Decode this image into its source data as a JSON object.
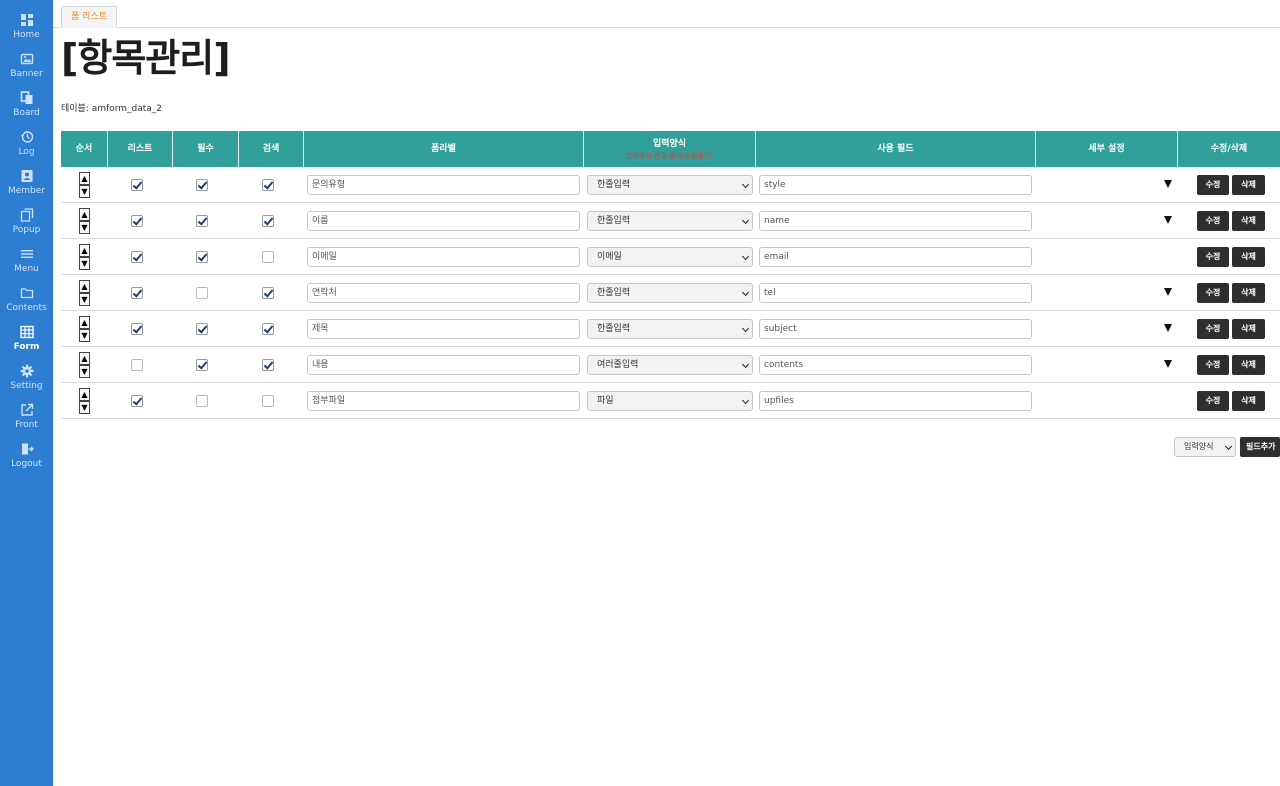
{
  "sidebar": {
    "items": [
      {
        "label": "Home",
        "icon": "dashboard-icon",
        "active": false
      },
      {
        "label": "Banner",
        "icon": "image-icon",
        "active": false
      },
      {
        "label": "Board",
        "icon": "copy-icon",
        "active": false
      },
      {
        "label": "Log",
        "icon": "history-icon",
        "active": false
      },
      {
        "label": "Member",
        "icon": "contact-card-icon",
        "active": false
      },
      {
        "label": "Popup",
        "icon": "popup-icon",
        "active": false
      },
      {
        "label": "Menu",
        "icon": "list-icon",
        "active": false
      },
      {
        "label": "Contents",
        "icon": "folder-icon",
        "active": false
      },
      {
        "label": "Form",
        "icon": "table-icon",
        "active": true
      },
      {
        "label": "Setting",
        "icon": "gear-icon",
        "active": false
      },
      {
        "label": "Front",
        "icon": "external-link-icon",
        "active": false
      },
      {
        "label": "Logout",
        "icon": "logout-icon",
        "active": false
      }
    ]
  },
  "tab": {
    "label": "폼 리스트"
  },
  "page": {
    "title": "[항목관리]",
    "table_label": "테이블: amform_data_2"
  },
  "table": {
    "headers": {
      "order": "순서",
      "list": "리스트",
      "required": "필수",
      "search": "검색",
      "form_label": "폼라벨",
      "input_type": "입력양식",
      "input_type_sub": "입력양식 변경 불가(수정불가)",
      "field": "사용 필드",
      "detail": "세부 설정",
      "actions": "수정/삭제"
    },
    "order_up": "▲",
    "order_down": "▼",
    "edit_label": "수정",
    "delete_label": "삭제",
    "rows": [
      {
        "list": true,
        "required": true,
        "search": true,
        "label": "문의유형",
        "type": "한줄입력",
        "field": "style",
        "has_detail": true
      },
      {
        "list": true,
        "required": true,
        "search": true,
        "label": "이름",
        "type": "한줄입력",
        "field": "name",
        "has_detail": true
      },
      {
        "list": true,
        "required": true,
        "search": false,
        "label": "이메일",
        "type": "이메일",
        "field": "email",
        "has_detail": false
      },
      {
        "list": true,
        "required": false,
        "search": true,
        "label": "연락처",
        "type": "한줄입력",
        "field": "tel",
        "has_detail": true
      },
      {
        "list": true,
        "required": true,
        "search": true,
        "label": "제목",
        "type": "한줄입력",
        "field": "subject",
        "has_detail": true
      },
      {
        "list": false,
        "required": true,
        "search": true,
        "label": "내용",
        "type": "여러줄입력",
        "field": "contents",
        "has_detail": true
      },
      {
        "list": true,
        "required": false,
        "search": false,
        "label": "첨부파일",
        "type": "파일",
        "field": "upfiles",
        "has_detail": false
      }
    ]
  },
  "footer": {
    "type_select": "입력양식",
    "add_button": "필드추가"
  },
  "colors": {
    "sidebar": "#2d7dd2",
    "header": "#31a09a",
    "button": "#2e2e2e",
    "tab_text": "#e08a1e"
  }
}
